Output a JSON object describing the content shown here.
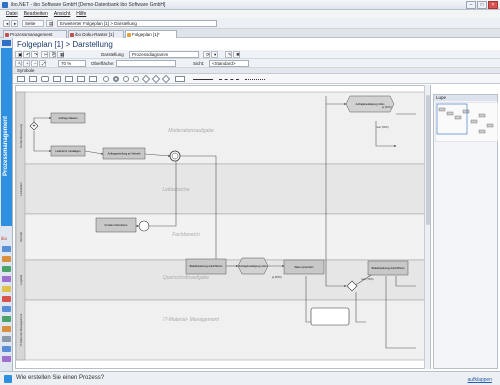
{
  "window": {
    "title": "ibo.NET - ibo Software GmbH [Demo-Datenbank ibo Software GmbH]",
    "buttons": [
      "–",
      "□",
      "×"
    ]
  },
  "menu": [
    "Datei",
    "Bearbeiten",
    "Ansicht",
    "Hilfe"
  ],
  "toolbar": {
    "home_label": "Seite",
    "search_value": "Erweiterter Folgeplan [1] > Darstellung"
  },
  "tabs": [
    {
      "label": "Prozessmanagement",
      "active": false
    },
    {
      "label": "ibo Doku-Raster [1]",
      "active": false
    },
    {
      "label": "Folgeplan [1]*",
      "active": true
    }
  ],
  "sidebar": {
    "main_label": "Prozessmanagement",
    "small_label": "ibo"
  },
  "page": {
    "title": "Folgeplan [1] > Darstellung"
  },
  "toolbar2": {
    "darstellung_label": "Darstellung",
    "diagram_type": "Prozessdiagramm"
  },
  "toolbar3": {
    "zoom": "70 %",
    "oberflaeche_label": "Oberfläche:",
    "sicht_label": "Sicht:",
    "sicht_value": "<Standard>"
  },
  "symbolbar": {
    "label": "Symbole"
  },
  "lupe": {
    "label": "Lupe"
  },
  "diagram": {
    "lanes": [
      "Moderationsaufgabe",
      "Leitbereiche",
      "Fachbereich",
      "Querschnittsaufgabe",
      "IT-Material- Management"
    ],
    "lane_headers": [
      "Kundenbetreuung",
      "Leitstellen",
      "Vertrieb",
      "Logistik",
      "IT-Material-Management"
    ],
    "tasks": [
      "Auftrag erfassen",
      "Lieferterm. bestätigen",
      "Auftragserteilung an Vertrieb",
      "Kunden informieren",
      "Bedarfsplanung durchführen",
      "Auftragsbestätigung prüfen",
      "Ware versenden",
      "Auftragsbestätigung prüfen",
      "Bedarfsplanung durchführen"
    ],
    "edge_labels": [
      "ja (30%)",
      "nein (50%)",
      "ja (50%)",
      "nein (70%)"
    ]
  },
  "status": {
    "question": "Wie erstellen Sie einen Prozess?",
    "link": "aufklappen"
  }
}
